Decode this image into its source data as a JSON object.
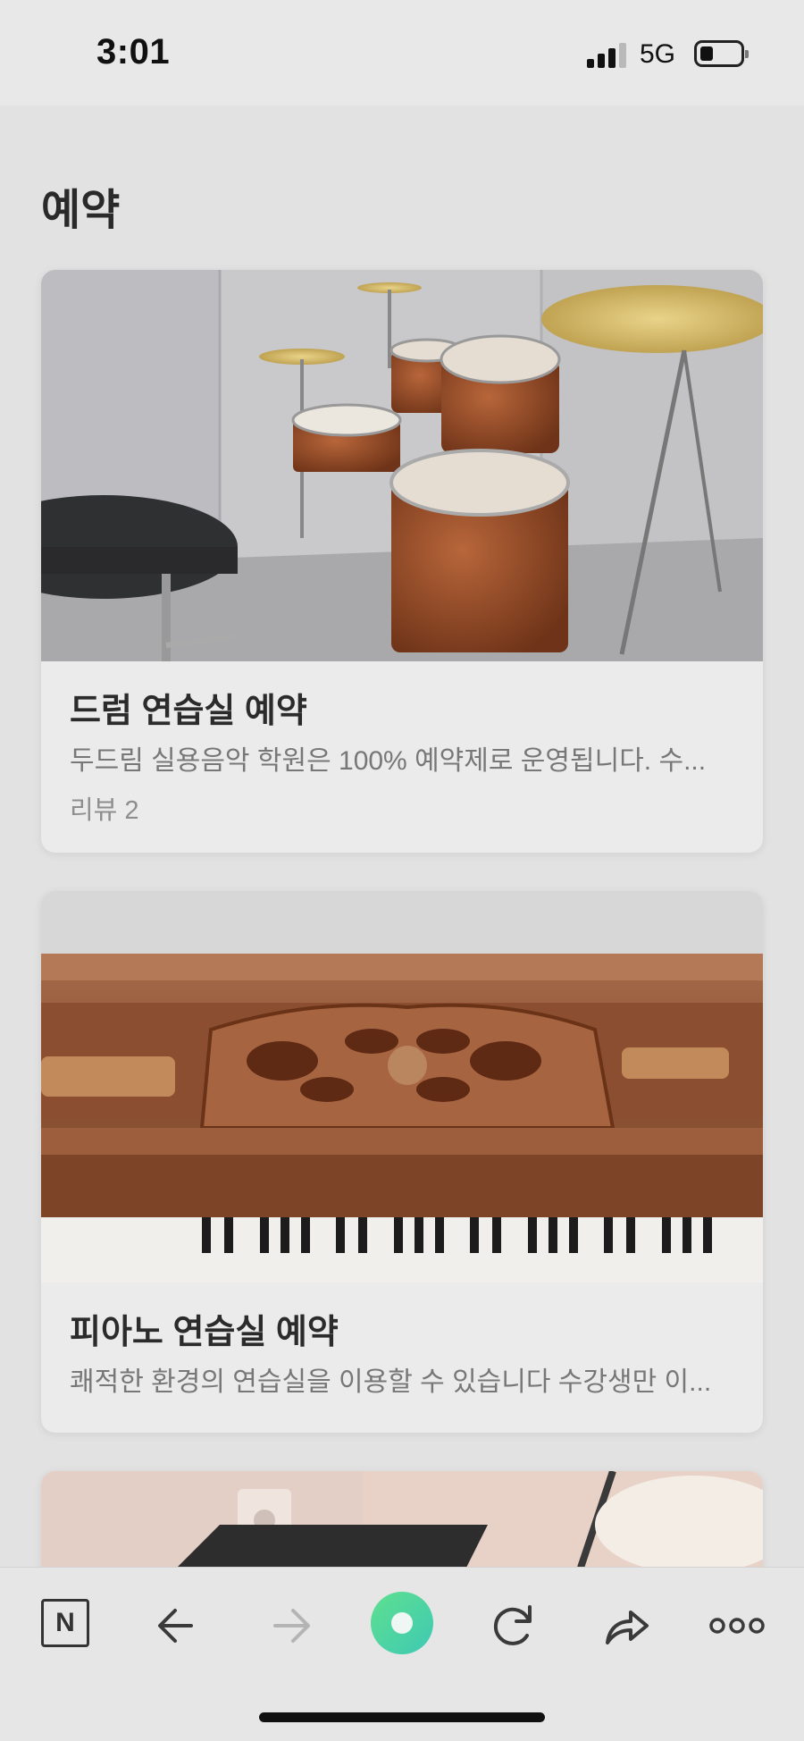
{
  "status_bar": {
    "time": "3:01",
    "network": "5G"
  },
  "page": {
    "title": "예약"
  },
  "cards": [
    {
      "title": "드럼 연습실 예약",
      "description": "두드림 실용음악 학원은 100% 예약제로 운영됩니다. 수...",
      "review": "리뷰 2",
      "image": "drum-kit-photo"
    },
    {
      "title": "피아노 연습실 예약",
      "description": "쾌적한 환경의 연습실을 이용할 수 있습니다 수강생만 이...",
      "image": "upright-piano-photo"
    },
    {
      "image": "practice-room-photo"
    }
  ],
  "toolbar": {
    "n_label": "N",
    "icons": [
      "naver-n-icon",
      "back-arrow-icon",
      "forward-arrow-icon",
      "green-circle-icon",
      "refresh-icon",
      "share-icon",
      "more-icon"
    ]
  },
  "colors": {
    "background": "#e2e2e2",
    "card": "#ebebeb",
    "accent_green": "#4fd3a0",
    "text_primary": "#2b2b2b",
    "text_secondary": "#777777"
  }
}
